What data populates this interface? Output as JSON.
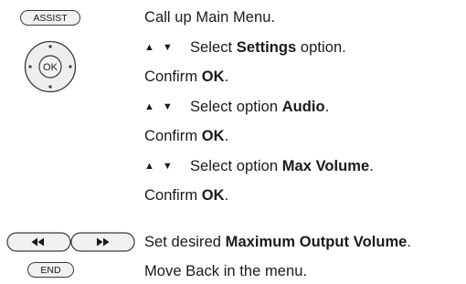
{
  "keys": {
    "assist": "ASSIST",
    "ok": "OK",
    "end": "END",
    "rewind": "rewind-icon",
    "fast_forward": "fast-forward-icon"
  },
  "steps": [
    {
      "prefix": "Call up Main Menu.",
      "bold": "",
      "suffix": ""
    },
    {
      "prefix": "Select ",
      "bold": "Settings",
      "suffix": " option."
    },
    {
      "prefix": "Confirm ",
      "bold": "OK",
      "suffix": "."
    },
    {
      "prefix": "Select option ",
      "bold": "Audio",
      "suffix": "."
    },
    {
      "prefix": "Confirm ",
      "bold": "OK",
      "suffix": "."
    },
    {
      "prefix": "Select option ",
      "bold": "Max Volume",
      "suffix": "."
    },
    {
      "prefix": "Confirm ",
      "bold": "OK",
      "suffix": "."
    },
    {
      "prefix": "Set desired ",
      "bold": "Maximum Output Volume",
      "suffix": "."
    },
    {
      "prefix": "Move Back in the menu.",
      "bold": "",
      "suffix": ""
    }
  ]
}
